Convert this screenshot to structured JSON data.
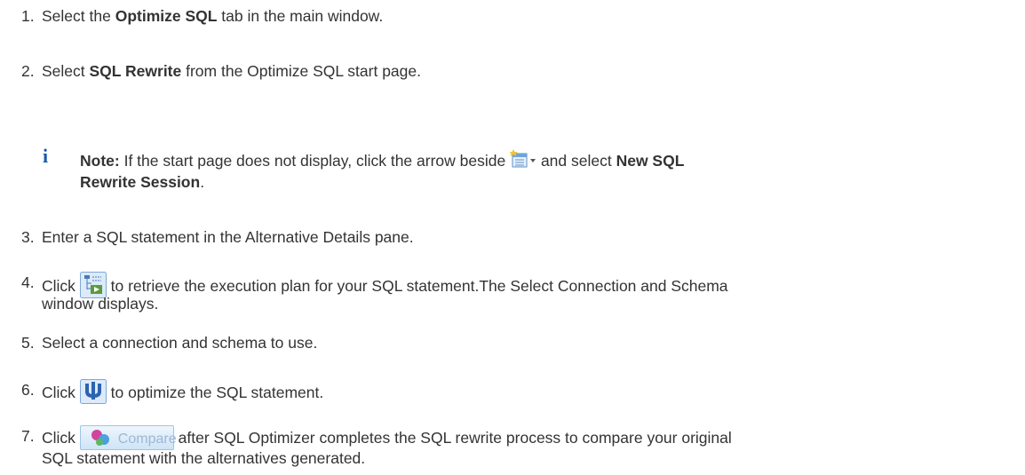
{
  "steps": [
    {
      "num": "1.",
      "pre": "Select the ",
      "bold": "Optimize SQL",
      "post": " tab in the main window."
    },
    {
      "num": "2.",
      "pre": "Select ",
      "bold": "SQL Rewrite",
      "post": " from the Optimize SQL start page."
    },
    {
      "num": "3.",
      "text": "Enter a SQL statement in the Alternative Details pane."
    },
    {
      "num": "4.",
      "pre": "Click ",
      "post": " to retrieve the execution plan for your SQL statement.The Select Connection and Schema",
      "line2": "window displays."
    },
    {
      "num": "5.",
      "text": "Select a connection and schema to use."
    },
    {
      "num": "6.",
      "pre": "Click ",
      "post": " to optimize the SQL statement."
    },
    {
      "num": "7.",
      "pre": "Click ",
      "post": " after SQL Optimizer completes the SQL rewrite process to compare your original",
      "line2": "SQL statement with the alternatives generated."
    }
  ],
  "note": {
    "label": "Note:",
    "pre": " If the start page does not display, click the arrow beside ",
    "mid": " and select ",
    "bold1": "New SQL",
    "bold2": "Rewrite Session",
    "end": "."
  },
  "compare_button": {
    "label": "Compare"
  },
  "icons": {
    "note": "info-icon",
    "new_session": "new-sql-session-icon",
    "plan": "execution-plan-icon",
    "optimize": "optimize-icon",
    "compare": "compare-icon"
  }
}
